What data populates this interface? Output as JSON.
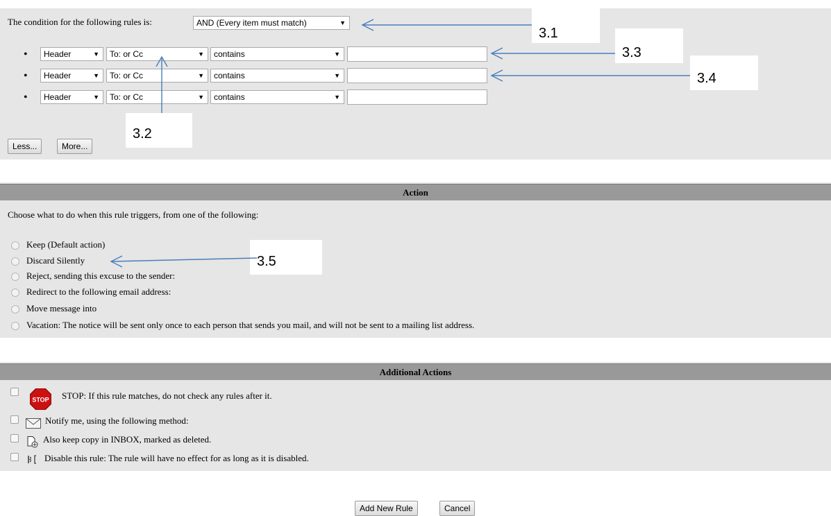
{
  "conditions": {
    "intro": "The condition for the following rules is:",
    "match_mode": "AND (Every item must match)",
    "rows": [
      {
        "field": "Header",
        "header": "To: or Cc",
        "operator": "contains",
        "value": ""
      },
      {
        "field": "Header",
        "header": "To: or Cc",
        "operator": "contains",
        "value": ""
      },
      {
        "field": "Header",
        "header": "To: or Cc",
        "operator": "contains",
        "value": ""
      }
    ],
    "less_label": "Less...",
    "more_label": "More..."
  },
  "action": {
    "title": "Action",
    "intro": "Choose what to do when this rule triggers, from one of the following:",
    "options": [
      "Keep (Default action)",
      "Discard Silently",
      "Reject, sending this excuse to the sender:",
      "Redirect to the following email address:",
      "Move message into",
      "Vacation: The notice will be sent only once to each person that sends you mail, and will not be sent to a mailing list address."
    ]
  },
  "additional": {
    "title": "Additional Actions",
    "items": [
      {
        "label": "STOP: If this rule matches, do not check any rules after it.",
        "icon": "stop-icon",
        "icon_text": "STOP"
      },
      {
        "label": "Notify me, using the following method:",
        "icon": "envelope-icon"
      },
      {
        "label": "Also keep copy in INBOX, marked as deleted.",
        "icon": "copy-document-icon"
      },
      {
        "label": "Disable this rule: The rule will have no effect for as long as it is disabled.",
        "icon": "disable-rule-icon"
      }
    ]
  },
  "footer": {
    "add_label": "Add New Rule",
    "cancel_label": "Cancel"
  },
  "annotations": {
    "c1": "3.1",
    "c2": "3.2",
    "c3": "3.3",
    "c4": "3.4",
    "c5": "3.5"
  },
  "colors": {
    "panel": "#e6e6e6",
    "header": "#999999",
    "arrow": "#4a7ebb",
    "stop": "#cc1111"
  }
}
